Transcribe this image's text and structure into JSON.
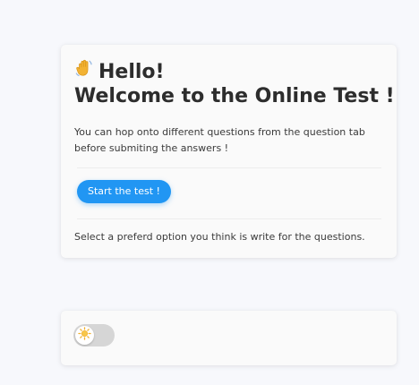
{
  "intro": {
    "wave_icon": "waving-hand-icon",
    "hello": "Hello!",
    "welcome": "Welcome to the Online Test !",
    "description": "You can hop onto different questions from the question tab before submiting the answers !",
    "start_button": "Start the test !",
    "footnote": "Select a preferd option you think is write for the questions."
  },
  "theme_toggle": {
    "icon": "sun-icon",
    "state": "light"
  },
  "colors": {
    "accent": "#2196f3",
    "background": "#f7f8fc",
    "card": "#fafafa",
    "sun": "#f2b233"
  }
}
